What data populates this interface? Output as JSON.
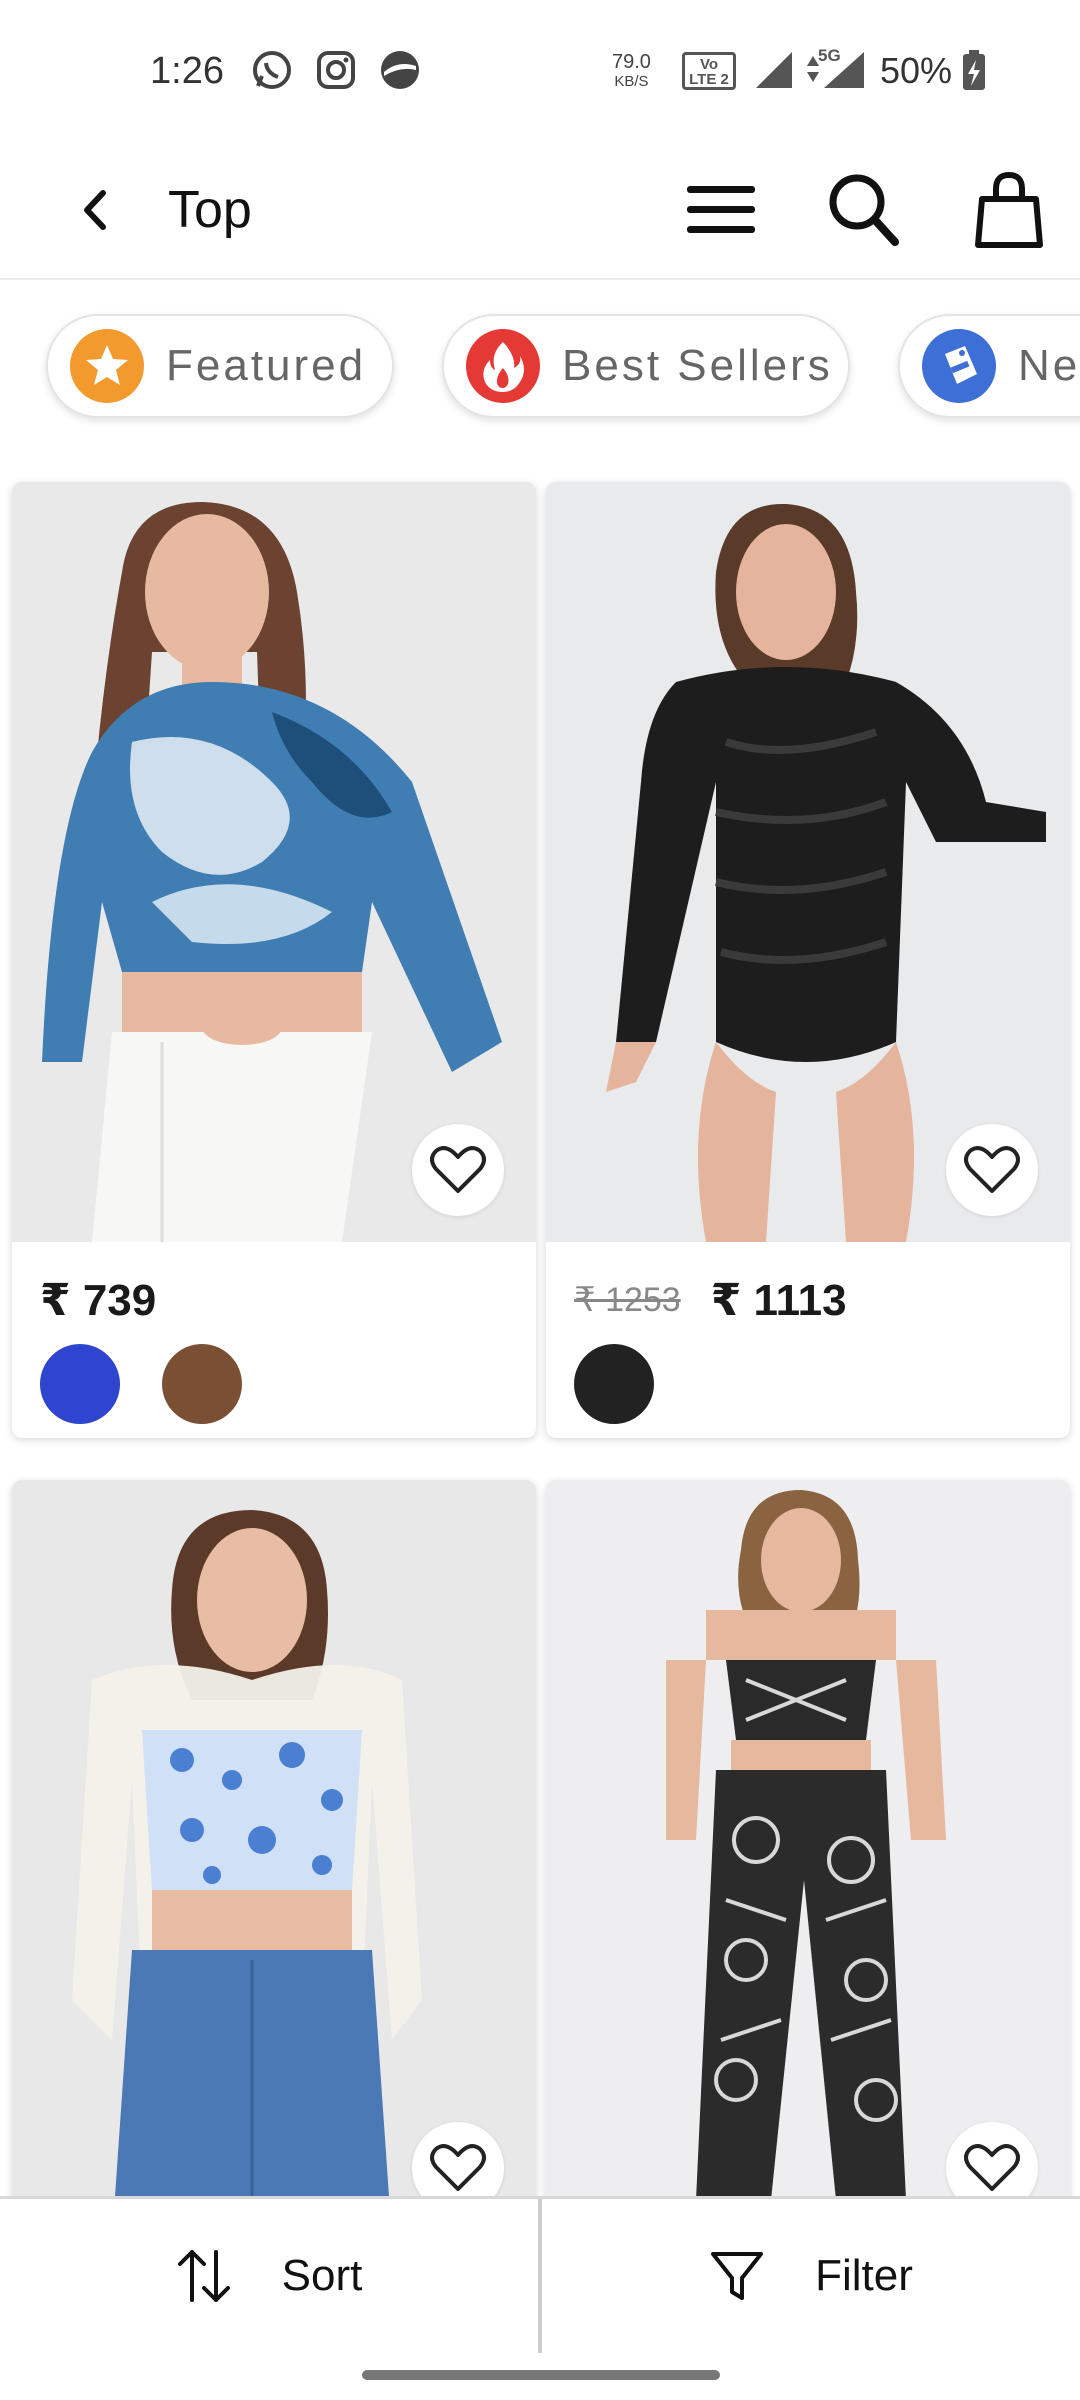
{
  "status_bar": {
    "time": "1:26",
    "net_speed_value": "79.0",
    "net_speed_unit": "KB/S",
    "volte_line1": "Vo",
    "volte_line2": "LTE 2",
    "network": "5G",
    "battery": "50%",
    "notification_icons": [
      "whatsapp-icon",
      "instagram-icon",
      "app-icon"
    ]
  },
  "header": {
    "title": "Top",
    "actions": [
      "menu-icon",
      "search-icon",
      "shopping-bag-icon"
    ]
  },
  "chips": [
    {
      "label": "Featured",
      "icon": "star-icon",
      "color": "#f39a2e"
    },
    {
      "label": "Best Sellers",
      "icon": "flame-icon",
      "color": "#e53935"
    },
    {
      "label": "New",
      "icon": "new-tag-icon",
      "color": "#3d6fd6"
    }
  ],
  "products": [
    {
      "price": "₹ 739",
      "mrp": "",
      "colors": [
        "#2f45cf",
        "#7a4f33"
      ],
      "image": "model in blue marble print crop top"
    },
    {
      "price": "₹ 1113",
      "mrp": "₹ 1253",
      "colors": [
        "#222222"
      ],
      "image": "model in black textured bodysuit"
    },
    {
      "price": "",
      "mrp": "",
      "colors": [],
      "image": "model in blue floral crop top with white shrug"
    },
    {
      "price": "",
      "mrp": "",
      "colors": [],
      "image": "model in black bandana print co-ord set"
    }
  ],
  "bottom_bar": {
    "sort_label": "Sort",
    "filter_label": "Filter"
  }
}
